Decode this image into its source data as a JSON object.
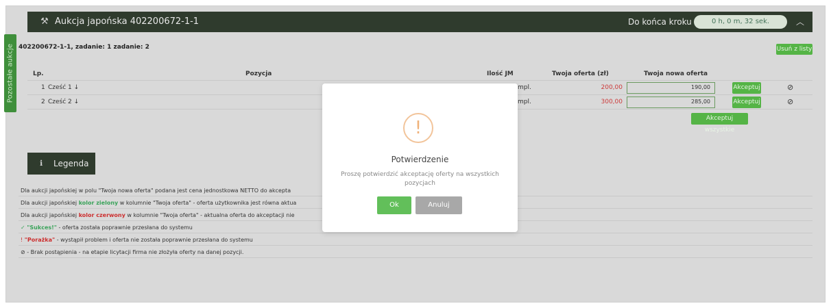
{
  "sidebar": {
    "tab_label": "Pozostałe aukcje"
  },
  "auction": {
    "title": "Aukcja japońska 402200672-1-1",
    "timer_label": "Do końca kroku 1",
    "timer_value": "0 h, 0 m, 32 sek.",
    "task_line": "402200672-1-1, zadanie: 1 zadanie: 2",
    "remove_label": "Usuń z listy"
  },
  "table": {
    "headers": {
      "lp": "Lp.",
      "position": "Pozycja",
      "qty_unit": "Ilość JM",
      "your_offer": "Twoja oferta (zł)",
      "new_offer": "Twoja nowa oferta"
    },
    "rows": [
      {
        "lp": "1",
        "name": "Cześć 1 ↓",
        "unit": "mpl.",
        "offer": "200,00",
        "new_offer": "190,00",
        "accept": "Akceptuj"
      },
      {
        "lp": "2",
        "name": "Cześć 2 ↓",
        "unit": "mpl.",
        "offer": "300,00",
        "new_offer": "285,00",
        "accept": "Akceptuj"
      }
    ],
    "accept_all": "Akceptuj wszystkie"
  },
  "legend": {
    "title": "Legenda",
    "line1": "Dla aukcji japońskiej w polu \"Twoja nowa oferta\" podana jest cena jednostkowa NETTO do akcepta",
    "line2_pre": "Dla aukcji japońskiej ",
    "line2_bold": "kolor zielony",
    "line2_post": " w kolumnie \"Twoja oferta\" - oferta użytkownika jest równa aktua",
    "line3_pre": "Dla aukcji japońskiej ",
    "line3_bold": "kolor czerwony",
    "line3_post": " w kolumnie \"Twoja oferta\" - aktualna oferta do akceptacji nie",
    "line4_bold": "\"Sukces!\"",
    "line4_post": " - oferta została poprawnie przesłana do systemu",
    "line5_bold": "\"Porażka\"",
    "line5_post": " - wystąpił problem i oferta nie została poprawnie przesłana do systemu",
    "line6_post": " - Brak postąpienia - na etapie licytacji firma nie złożyła oferty na danej pozycji."
  },
  "modal": {
    "title": "Potwierdzenie",
    "text": "Proszę potwierdzić akceptację oferty na wszystkich pozycjach",
    "ok": "Ok",
    "cancel": "Anuluj"
  },
  "icons": {
    "auction": "gavel-icon",
    "collapse": "chevron-up-icon",
    "legend": "info-icon",
    "block": "block-icon",
    "warning": "exclamation-icon",
    "success": "check-circle-icon",
    "failure": "exclamation-circle-icon"
  },
  "colors": {
    "header_bg": "#2f3b2d",
    "accent_green": "#55b446",
    "offer_red": "#cc3a3a",
    "warning_orange": "#f0b27a"
  }
}
